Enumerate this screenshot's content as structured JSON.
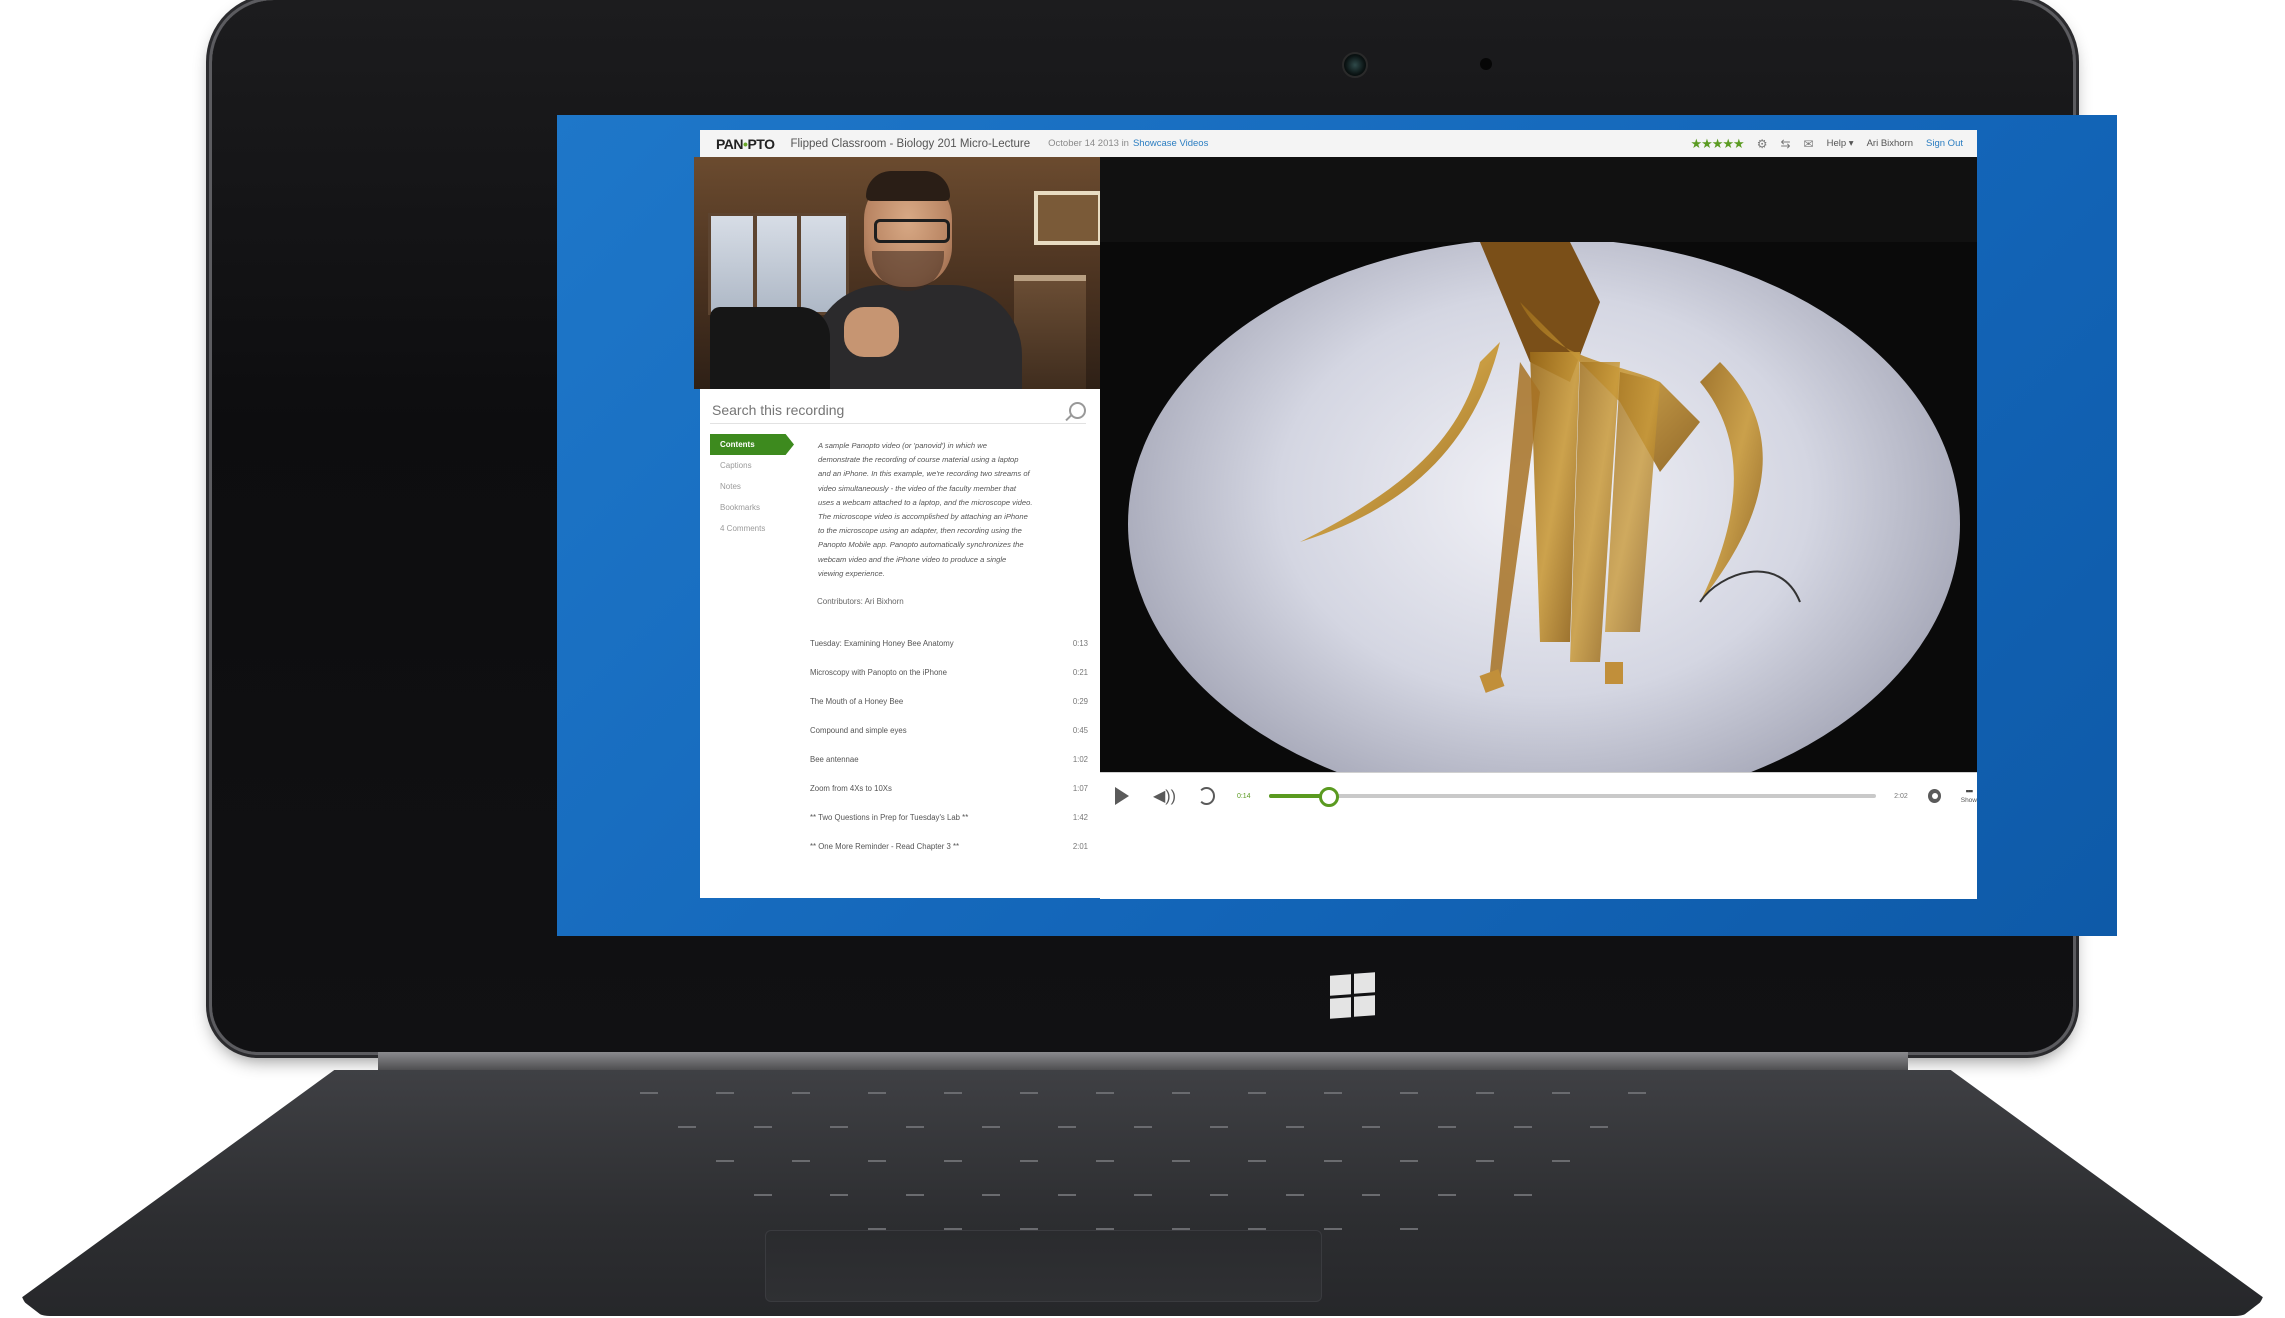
{
  "app": {
    "logo_pre": "PAN",
    "logo_o": "•",
    "logo_post": "PTO",
    "title": "Flipped Classroom - Biology 201 Micro-Lecture",
    "date": "October 14 2013 in",
    "folder": "Showcase Videos",
    "rating_stars": "★★★★★",
    "help_label": "Help ▾",
    "user_name": "Ari Bixhorn",
    "sign_out": "Sign Out"
  },
  "sidebar": {
    "search_placeholder": "Search this recording",
    "tabs": [
      {
        "label": "Contents",
        "active": true
      },
      {
        "label": "Captions",
        "active": false
      },
      {
        "label": "Notes",
        "active": false
      },
      {
        "label": "Bookmarks",
        "active": false
      },
      {
        "label": "4 Comments",
        "active": false
      }
    ],
    "description_lines": [
      "A sample Panopto video (or 'panovid') in which we",
      "demonstrate the recording of course material using a laptop",
      "and an iPhone. In this example, we're recording two streams of",
      "video simultaneously - the video of the faculty member that",
      "uses a webcam attached to a laptop, and the microscope video.",
      "The microscope video is accomplished by attaching an iPhone",
      "to the microscope using an adapter, then recording using the",
      "Panopto Mobile app. Panopto automatically synchronizes the",
      "webcam video and the iPhone video to produce a single",
      "viewing experience."
    ],
    "contributors": "Contributors: Ari Bixhorn",
    "toc": [
      {
        "title": "Tuesday: Examining Honey Bee Anatomy",
        "time": "0:13"
      },
      {
        "title": "Microscopy with Panopto on the iPhone",
        "time": "0:21"
      },
      {
        "title": "The Mouth of a Honey Bee",
        "time": "0:29"
      },
      {
        "title": "Compound and simple eyes",
        "time": "0:45"
      },
      {
        "title": "Bee antennae",
        "time": "1:02"
      },
      {
        "title": "Zoom from 4Xs to 10Xs",
        "time": "1:07"
      },
      {
        "title": "** Two Questions in Prep for Tuesday's Lab **",
        "time": "1:42"
      },
      {
        "title": "** One More Reminder - Read Chapter 3 **",
        "time": "2:01"
      }
    ]
  },
  "player": {
    "elapsed": "0:14",
    "duration": "2:02",
    "progress_fraction": 0.1,
    "show_label": "Show"
  },
  "colors": {
    "accent_green": "#5a9a20",
    "desktop_blue": "#1365b8",
    "link_blue": "#2a7dc1"
  },
  "icons": [
    "play-icon",
    "volume-icon",
    "rewind-icon",
    "gear-icon",
    "search-icon",
    "windows-logo-icon"
  ]
}
